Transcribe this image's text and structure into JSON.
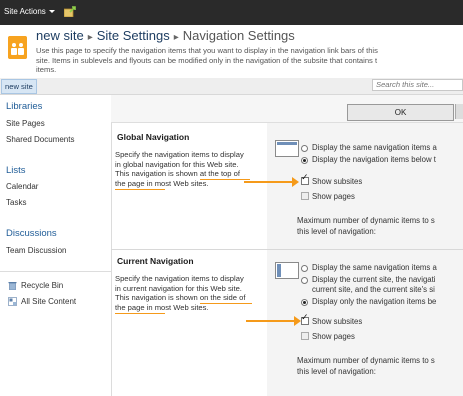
{
  "topbar": {
    "site_actions": "Site Actions"
  },
  "header": {
    "site": "new site",
    "separator": "▸",
    "section": "Site Settings",
    "page": "Navigation Settings",
    "description_lines": [
      "Use this page to specify the navigation items that you want to display in the navigation link bars of this",
      "site. Items in sublevels and flyouts can be modified only in the navigation of the subsite that contains t",
      "items."
    ]
  },
  "tabrow": {
    "tab": "new site",
    "search_placeholder": "Search this site..."
  },
  "leftnav": {
    "libraries": "Libraries",
    "site_pages": "Site Pages",
    "shared_documents": "Shared Documents",
    "lists": "Lists",
    "calendar": "Calendar",
    "tasks": "Tasks",
    "discussions": "Discussions",
    "team_discussion": "Team Discussion",
    "recycle_bin": "Recycle Bin",
    "all_site_content": "All Site Content"
  },
  "actions": {
    "ok": "OK"
  },
  "global_nav": {
    "title": "Global Navigation",
    "description": "Specify the navigation items to display\nin global navigation for this Web site.\nThis navigation is shown at the top of\nthe page in most Web sites.",
    "opt_same": "Display the same navigation items a",
    "opt_below": "Display the navigation items below t",
    "show_subsites": "Show subsites",
    "show_pages": "Show pages",
    "max_items_line1": "Maximum number of dynamic items to s",
    "max_items_line2": "this level of navigation:"
  },
  "current_nav": {
    "title": "Current Navigation",
    "description": "Specify the navigation items to display\nin current navigation for this Web site.\nThis navigation is shown on the side of\nthe page in most Web sites.",
    "opt_same": "Display the same navigation items a",
    "opt_current_line1": "Display the current site, the navigati",
    "opt_current_line2": "current site, and the current site's si",
    "opt_only": "Display only the navigation items be",
    "show_subsites": "Show subsites",
    "show_pages": "Show pages",
    "max_items_line1": "Maximum number of dynamic items to s",
    "max_items_line2": "this level of navigation:"
  },
  "colors": {
    "accent_arrow": "#f59a1a",
    "link": "#1f5c97",
    "topbar": "#2a2a2a"
  }
}
